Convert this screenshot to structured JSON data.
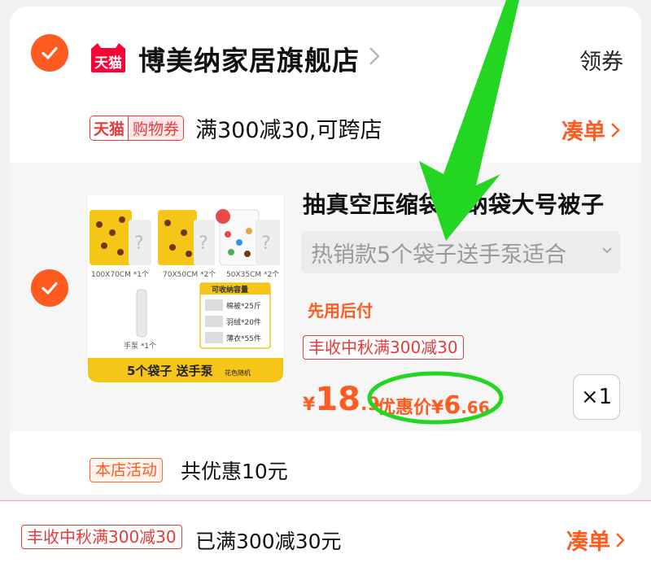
{
  "shop": {
    "logo_text": "天猫",
    "name": "博美纳家居旗舰店",
    "coupon_link": "领券"
  },
  "platform_coupon": {
    "tag_left": "天猫",
    "tag_right": "购物券",
    "text": "满300减30,可跨店",
    "action": "凑单"
  },
  "product": {
    "title": "抽真空压缩袋收纳袋大号被子",
    "sku": "热销款5个袋子送手泵适合",
    "pay_later": "先用后付",
    "promo_tag": "丰收中秋满300减30",
    "price_symbol": "¥",
    "price_int": "18",
    "price_dec": ".9",
    "discount_label": "优惠价",
    "discount_symbol": "¥",
    "discount_int": "6",
    "discount_dec": ".66",
    "quantity": "×1",
    "image": {
      "size_labels": [
        "100X70CM *1个",
        "70X50CM *2个",
        "50X35CM *2个"
      ],
      "random_badge": "花色随机",
      "capacity_title": "可收纳容量",
      "capacity_items": [
        "棉被*25斤",
        "羽绒*20件",
        "薄衣*55件"
      ],
      "pump_label": "手泵 *1个",
      "banner_main": "5个袋子 送手泵",
      "banner_sub": "花色随机"
    }
  },
  "shop_activity": {
    "tag": "本店活动",
    "text": "共优惠10元"
  },
  "bottom": {
    "tag": "丰收中秋满300减30",
    "text": "已满300减30元",
    "action": "凑单"
  },
  "colors": {
    "accent": "#ff5a1f",
    "tmall_red": "#e53b3b",
    "annotation_green": "#22d622"
  },
  "icons": [
    "check-icon",
    "chevron-right-icon",
    "chevron-down-icon",
    "tmall-logo-icon"
  ]
}
